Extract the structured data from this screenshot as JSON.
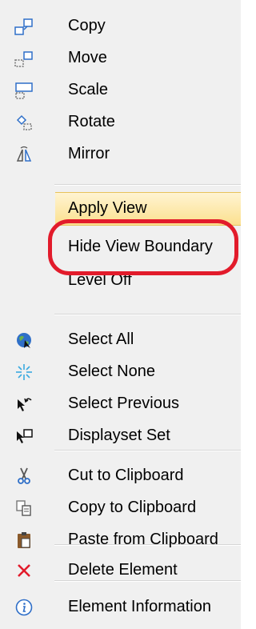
{
  "menu": {
    "items": [
      {
        "label": "Copy",
        "icon": "copy-element-icon"
      },
      {
        "label": "Move",
        "icon": "move-element-icon"
      },
      {
        "label": "Scale",
        "icon": "scale-element-icon"
      },
      {
        "label": "Rotate",
        "icon": "rotate-element-icon"
      },
      {
        "label": "Mirror",
        "icon": "mirror-element-icon"
      },
      {
        "label": "Apply View"
      },
      {
        "label": "Hide View Boundary"
      },
      {
        "label": "Level Off"
      },
      {
        "label": "Select All",
        "icon": "select-all-icon"
      },
      {
        "label": "Select None",
        "icon": "select-none-icon"
      },
      {
        "label": "Select Previous",
        "icon": "select-previous-icon"
      },
      {
        "label": "Displayset Set",
        "icon": "displayset-set-icon"
      },
      {
        "label": "Cut to Clipboard",
        "icon": "scissors-icon"
      },
      {
        "label": "Copy to Clipboard",
        "icon": "copy-clipboard-icon"
      },
      {
        "label": "Paste from Clipboard",
        "icon": "paste-clipboard-icon"
      },
      {
        "label": "Delete Element",
        "icon": "delete-x-icon"
      },
      {
        "label": "Element Information",
        "icon": "info-icon"
      }
    ],
    "hovered_item": "Apply View",
    "annotation_target": "Hide View Boundary"
  },
  "colors": {
    "highlight": "#fbe08f",
    "annotation": "#e21b2b",
    "delete_icon": "#e21b2b",
    "icon_blue": "#2f6fc8"
  }
}
